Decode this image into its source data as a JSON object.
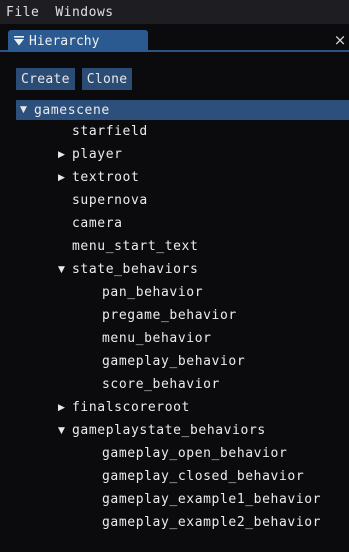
{
  "menubar": {
    "items": [
      "File",
      "Windows"
    ]
  },
  "window": {
    "title": "Hierarchy",
    "close_glyph": "×",
    "collapse_icon": "triangle-down-icon"
  },
  "toolbar": {
    "create_label": "Create",
    "clone_label": "Clone"
  },
  "tree": {
    "root": {
      "label": "gamescene",
      "expanded": true,
      "selected": true
    },
    "items": [
      {
        "label": "starfield",
        "depth": 1,
        "arrow": "none"
      },
      {
        "label": "player",
        "depth": 1,
        "arrow": "collapsed"
      },
      {
        "label": "textroot",
        "depth": 1,
        "arrow": "collapsed"
      },
      {
        "label": "supernova",
        "depth": 1,
        "arrow": "none"
      },
      {
        "label": "camera",
        "depth": 1,
        "arrow": "none"
      },
      {
        "label": "menu_start_text",
        "depth": 1,
        "arrow": "none"
      },
      {
        "label": "state_behaviors",
        "depth": 1,
        "arrow": "expanded"
      },
      {
        "label": "pan_behavior",
        "depth": 2,
        "arrow": "none"
      },
      {
        "label": "pregame_behavior",
        "depth": 2,
        "arrow": "none"
      },
      {
        "label": "menu_behavior",
        "depth": 2,
        "arrow": "none"
      },
      {
        "label": "gameplay_behavior",
        "depth": 2,
        "arrow": "none"
      },
      {
        "label": "score_behavior",
        "depth": 2,
        "arrow": "none"
      },
      {
        "label": "finalscoreroot",
        "depth": 1,
        "arrow": "collapsed"
      },
      {
        "label": "gameplaystate_behaviors",
        "depth": 1,
        "arrow": "expanded"
      },
      {
        "label": "gameplay_open_behavior",
        "depth": 2,
        "arrow": "none"
      },
      {
        "label": "gameplay_closed_behavior",
        "depth": 2,
        "arrow": "none"
      },
      {
        "label": "gameplay_example1_behavior",
        "depth": 2,
        "arrow": "none"
      },
      {
        "label": "gameplay_example2_behavior",
        "depth": 2,
        "arrow": "none"
      }
    ]
  },
  "colors": {
    "selection": "#2c4f7c",
    "tab": "#2a5a8f",
    "button": "#2b4c74",
    "background": "#0b0b0d"
  }
}
